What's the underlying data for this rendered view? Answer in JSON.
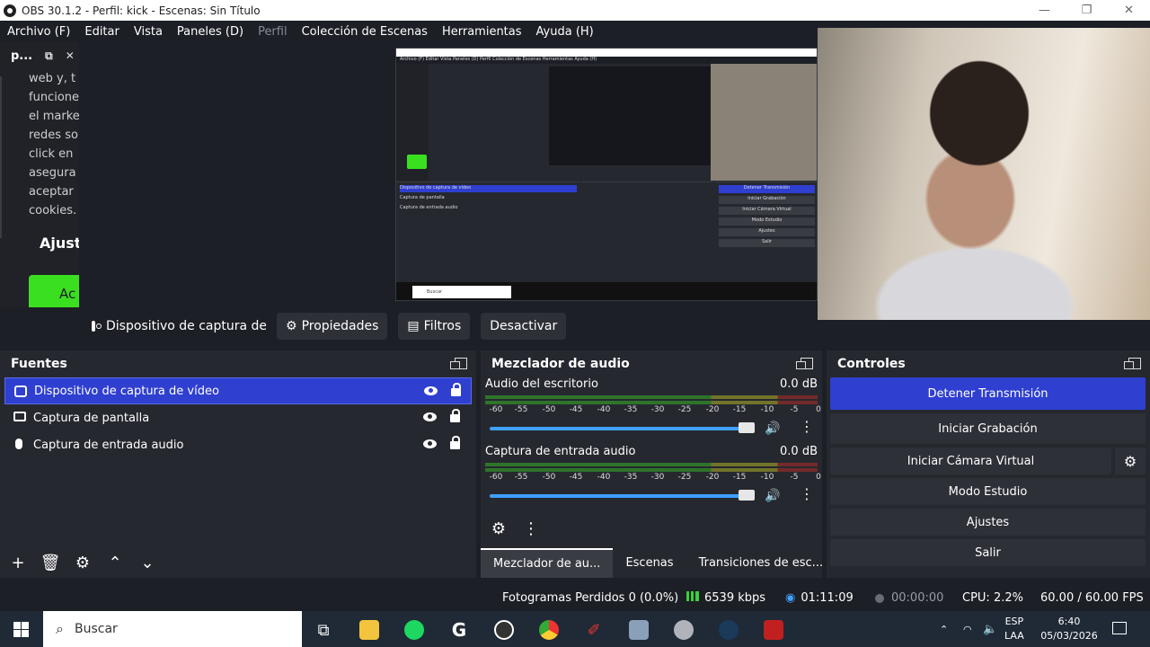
{
  "window": {
    "title": "OBS 30.1.2 - Perfil: kick - Escenas: Sin Título",
    "minimize": "—",
    "maximize": "❐",
    "close": "✕"
  },
  "menu": {
    "archivo": "Archivo (F)",
    "editar": "Editar",
    "vista": "Vista",
    "paneles": "Paneles (D)",
    "perfil": "Perfil",
    "coleccion": "Colección de Escenas",
    "herramientas": "Herramientas",
    "ayuda": "Ayuda (H)"
  },
  "left_dock": {
    "title": "p...",
    "lines": [
      "web y, t",
      "funcione",
      "el marke",
      "redes so",
      "click en",
      "asegura",
      "aceptar",
      "cookies."
    ],
    "heading": "Ajust",
    "button": "Ac"
  },
  "source_toolbar": {
    "source_name": "Dispositivo de captura de v",
    "properties": "Propiedades",
    "filters": "Filtros",
    "deactivate": "Desactivar"
  },
  "fuentes": {
    "title": "Fuentes",
    "items": [
      {
        "label": "Dispositivo de captura de vídeo",
        "icon": "camera-icon",
        "selected": true
      },
      {
        "label": "Captura de pantalla",
        "icon": "monitor-icon",
        "selected": false
      },
      {
        "label": "Captura de entrada audio",
        "icon": "microphone-icon",
        "selected": false
      }
    ]
  },
  "mixer": {
    "title": "Mezclador de audio",
    "channels": [
      {
        "name": "Audio del escritorio",
        "db": "0.0 dB",
        "volume": 0.98
      },
      {
        "name": "Captura de entrada audio",
        "db": "0.0 dB",
        "volume": 0.98
      }
    ],
    "scale": [
      "-60",
      "-55",
      "-50",
      "-45",
      "-40",
      "-35",
      "-30",
      "-25",
      "-20",
      "-15",
      "-10",
      "-5",
      "0"
    ],
    "tabs": [
      "Mezclador de au...",
      "Escenas",
      "Transiciones de esc..."
    ]
  },
  "controles": {
    "title": "Controles",
    "stop_stream": "Detener Transmisión",
    "start_recording": "Iniciar Grabación",
    "virtual_cam": "Iniciar Cámara Virtual",
    "studio_mode": "Modo Estudio",
    "settings": "Ajustes",
    "exit": "Salir"
  },
  "status": {
    "dropped_frames": "Fotogramas Perdidos 0 (0.0%)",
    "bitrate": "6539 kbps",
    "stream_time": "01:11:09",
    "rec_time": "00:00:00",
    "cpu": "CPU: 2.2%",
    "fps": "60.00 / 60.00 FPS"
  },
  "nested": {
    "menu_text": "Archivo (F)  Editar  Vista  Paneles (D)  Perfil  Colección de Escenas  Herramientas  Ayuda (H)",
    "rows": [
      "Dispositivo de captura de vídeo",
      "Captura de pantalla",
      "Captura de entrada audio"
    ],
    "ctrls": [
      "Detener Transmisión",
      "Iniciar Grabación",
      "Iniciar Cámara Virtual",
      "Modo Estudio",
      "Ajustes",
      "Salir"
    ],
    "search": "Buscar"
  },
  "taskbar": {
    "search_placeholder": "Buscar",
    "lang_top": "ESP",
    "lang_bottom": "LAA",
    "time": "6:40",
    "date": "05/03/2026"
  },
  "colors": {
    "accent": "#2f3fd0",
    "background": "#1d1f26",
    "panel": "#26282f"
  }
}
